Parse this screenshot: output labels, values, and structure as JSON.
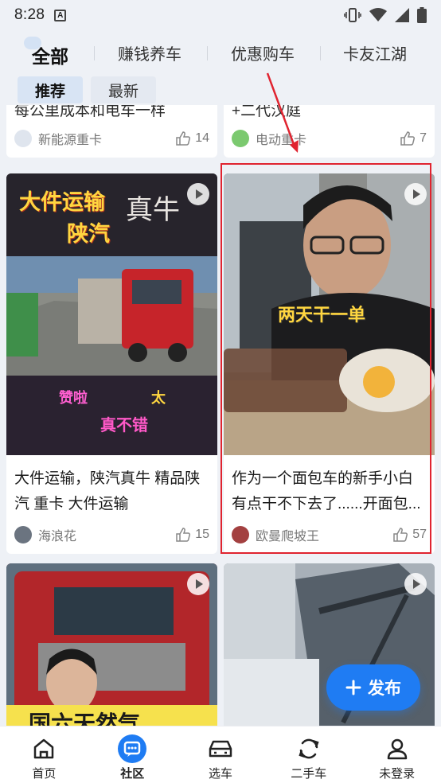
{
  "status_bar": {
    "time": "8:28",
    "notification_letter": "A"
  },
  "top_tabs": [
    {
      "label": "全部",
      "active": true
    },
    {
      "label": "赚钱养车",
      "active": false
    },
    {
      "label": "优惠购车",
      "active": false
    },
    {
      "label": "卡友江湖",
      "active": false
    }
  ],
  "sub_tabs": [
    {
      "label": "推荐",
      "active": true
    },
    {
      "label": "最新",
      "active": false
    }
  ],
  "feed": {
    "partial_left": {
      "title": "每公里成本和电车一样",
      "author": "新能源重卡",
      "likes": "14"
    },
    "partial_right": {
      "title": "+二代汉庭",
      "author": "电动重卡",
      "likes": "7"
    },
    "card_left": {
      "overlay_title_1": "大件运输",
      "overlay_title_2": "陕汽",
      "overlay_brand": "真牛",
      "overlay_praise_1": "赞啦",
      "overlay_praise_2": "真不错",
      "overlay_praise_3": "太",
      "title": "大件运输，陕汽真牛 精品陕汽 重卡 大件运输",
      "author": "海浪花",
      "likes": "15"
    },
    "card_right": {
      "overlay_caption": "两天干一单",
      "title": "作为一个面包车的新手小白有点干不下去了......开面包...",
      "author": "欧曼爬坡王",
      "likes": "57"
    },
    "card_bottom_left": {
      "overlay_text": "国六天然气"
    },
    "card_bottom_right": {}
  },
  "fab": {
    "label": "发布"
  },
  "bottom_nav": [
    {
      "label": "首页",
      "icon": "home-icon",
      "active": false
    },
    {
      "label": "社区",
      "icon": "community-icon",
      "active": true
    },
    {
      "label": "选车",
      "icon": "car-icon",
      "active": false
    },
    {
      "label": "二手车",
      "icon": "refresh-icon",
      "active": false
    },
    {
      "label": "未登录",
      "icon": "user-icon",
      "active": false
    }
  ],
  "colors": {
    "accent": "#1f7cf3",
    "highlight_box": "#e0232f",
    "background": "#eef1f6"
  }
}
